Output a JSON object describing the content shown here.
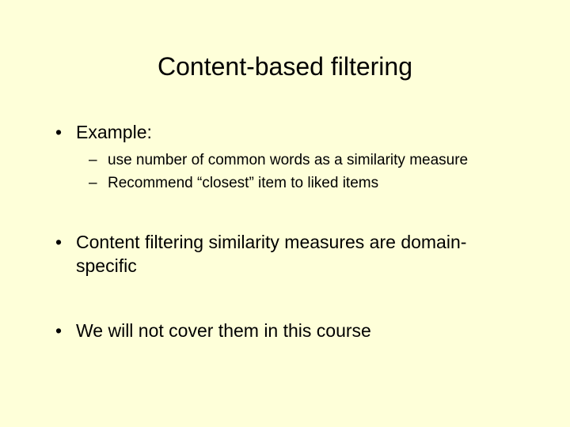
{
  "title": "Content-based filtering",
  "bullets": {
    "b1": "Example:",
    "b1_sub1": "use number of common words as a similarity measure",
    "b1_sub2": "Recommend “closest” item to liked items",
    "b2": "Content filtering similarity measures are domain-specific",
    "b3": "We will not cover them in this course"
  }
}
